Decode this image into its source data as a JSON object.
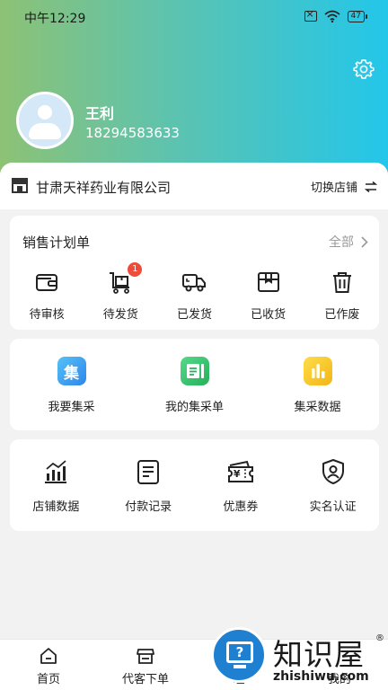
{
  "status_bar": {
    "time": "中午12:29",
    "battery": "47"
  },
  "user": {
    "name": "王利",
    "phone": "18294583633"
  },
  "store": {
    "name": "甘肃天祥药业有限公司",
    "switch_label": "切换店铺"
  },
  "orders": {
    "title": "销售计划单",
    "all_label": "全部",
    "items": [
      {
        "label": "待审核",
        "icon": "wallet-icon"
      },
      {
        "label": "待发货",
        "icon": "package-cart-icon",
        "badge": "1"
      },
      {
        "label": "已发货",
        "icon": "truck-icon"
      },
      {
        "label": "已收货",
        "icon": "box-icon"
      },
      {
        "label": "已作废",
        "icon": "trash-icon"
      }
    ]
  },
  "group_buy": {
    "items": [
      {
        "label": "我要集采",
        "icon_text": "集",
        "color": "#2f9cf0"
      },
      {
        "label": "我的集采单",
        "icon": "list-doc-icon",
        "color": "#34c46a"
      },
      {
        "label": "集采数据",
        "icon": "bar-chart-icon",
        "color": "#f5c525"
      }
    ]
  },
  "tools": {
    "items": [
      {
        "label": "店铺数据",
        "icon": "stats-icon"
      },
      {
        "label": "付款记录",
        "icon": "record-icon"
      },
      {
        "label": "优惠券",
        "icon": "coupon-icon",
        "icon_text": "¥"
      },
      {
        "label": "实名认证",
        "icon": "shield-user-icon"
      }
    ]
  },
  "bottom_nav": {
    "tabs": [
      {
        "label": "首页",
        "icon": "home-icon"
      },
      {
        "label": "代客下单",
        "icon": "shop-icon"
      },
      {
        "label": "理",
        "icon": ""
      },
      {
        "label": "我的",
        "icon": ""
      }
    ]
  },
  "watermark": {
    "text": "知识屋",
    "reg": "®",
    "url": "zhishiwu.com",
    "icon_text": "?"
  },
  "colors": {
    "gradient_start": "#8dc275",
    "gradient_end": "#23c6ea",
    "badge": "#ef4b3a",
    "watermark_blue": "#1f7fd1"
  }
}
